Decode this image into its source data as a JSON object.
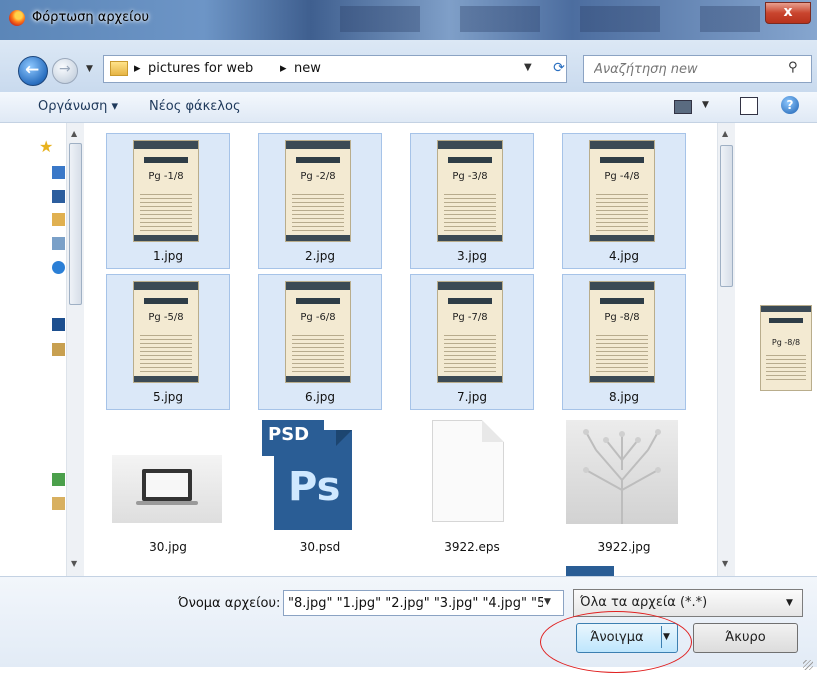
{
  "window": {
    "title": "Φόρτωση αρχείου",
    "close": "x"
  },
  "nav": {
    "path": [
      "pictures for web",
      "new"
    ],
    "search_placeholder": "Αναζήτηση new"
  },
  "toolbar": {
    "organize": "Οργάνωση",
    "new_folder": "Νέος φάκελος"
  },
  "files": [
    {
      "name": "1.jpg",
      "page": "Pg -1/8",
      "selected": true
    },
    {
      "name": "2.jpg",
      "page": "Pg -2/8",
      "selected": true
    },
    {
      "name": "3.jpg",
      "page": "Pg -3/8",
      "selected": true
    },
    {
      "name": "4.jpg",
      "page": "Pg -4/8",
      "selected": true
    },
    {
      "name": "5.jpg",
      "page": "Pg -5/8",
      "selected": true
    },
    {
      "name": "6.jpg",
      "page": "Pg -6/8",
      "selected": true
    },
    {
      "name": "7.jpg",
      "page": "Pg -7/8",
      "selected": true
    },
    {
      "name": "8.jpg",
      "page": "Pg -8/8",
      "selected": true
    },
    {
      "name": "30.jpg",
      "selected": false
    },
    {
      "name": "30.psd",
      "badge": "PSD",
      "logo": "Ps",
      "selected": false
    },
    {
      "name": "3922.eps",
      "selected": false
    },
    {
      "name": "3922.jpg",
      "selected": false
    }
  ],
  "preview": {
    "page": "Pg -8/8"
  },
  "footer": {
    "filename_label": "Όνομα αρχείου:",
    "filename_value": "\"8.jpg\" \"1.jpg\" \"2.jpg\" \"3.jpg\" \"4.jpg\" \"5",
    "filetype": "Όλα τα αρχεία (*.*)",
    "open": "Άνοιγμα",
    "cancel": "Άκυρο"
  },
  "colors": {
    "highlight_ring": "#e02020",
    "selection": "#dbe8f8"
  },
  "icons": [
    "firefox-icon",
    "back-icon",
    "forward-icon",
    "folder-icon",
    "refresh-icon",
    "search-icon",
    "view-icon",
    "preview-pane-icon",
    "help-icon"
  ]
}
